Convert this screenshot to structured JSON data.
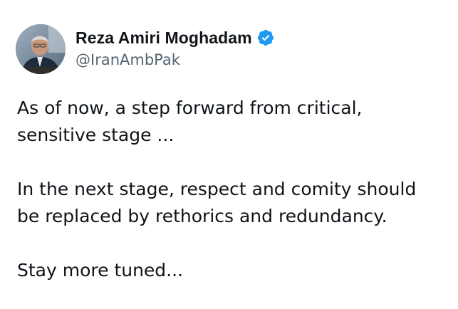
{
  "author": {
    "display_name": "Reza Amiri Moghadam",
    "handle": "@IranAmbPak",
    "verified": true,
    "verified_color": "#1d9bf0"
  },
  "tweet": {
    "paragraphs": [
      [
        "As of now, a step forward from critical,",
        "sensitive stage ..."
      ],
      [
        "In the next stage, respect and comity should",
        "be replaced by rethorics and redundancy."
      ],
      [
        "Stay more tuned..."
      ]
    ]
  },
  "colors": {
    "text_primary": "#0f1419",
    "text_secondary": "#536471",
    "background": "#ffffff"
  },
  "icons": {
    "avatar": "profile-photo",
    "verified": "verified-badge-icon"
  }
}
